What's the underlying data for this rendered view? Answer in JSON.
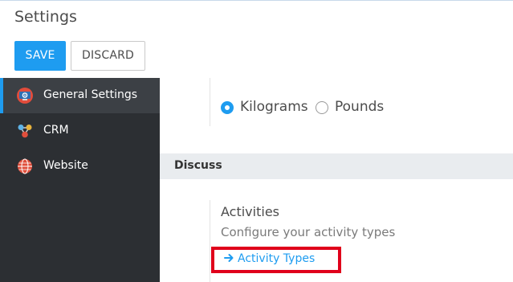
{
  "control_panel": {
    "title": "Settings",
    "save_label": "SAVE",
    "discard_label": "DISCARD"
  },
  "sidebar": {
    "items": [
      {
        "label": "General Settings",
        "icon": "general-settings-icon",
        "active": true
      },
      {
        "label": "CRM",
        "icon": "crm-icon",
        "active": false
      },
      {
        "label": "Website",
        "icon": "website-globe-icon",
        "active": false
      }
    ]
  },
  "main": {
    "weight_unit": {
      "options": [
        {
          "label": "Kilograms",
          "checked": true
        },
        {
          "label": "Pounds",
          "checked": false
        }
      ]
    },
    "discuss_section": {
      "title": "Discuss",
      "activities": {
        "title": "Activities",
        "description": "Configure your activity types",
        "link_label": "Activity Types"
      }
    }
  },
  "colors": {
    "accent": "#1e9cf0",
    "sidebar_bg": "#2c2f33",
    "highlight": "#e0001b"
  }
}
